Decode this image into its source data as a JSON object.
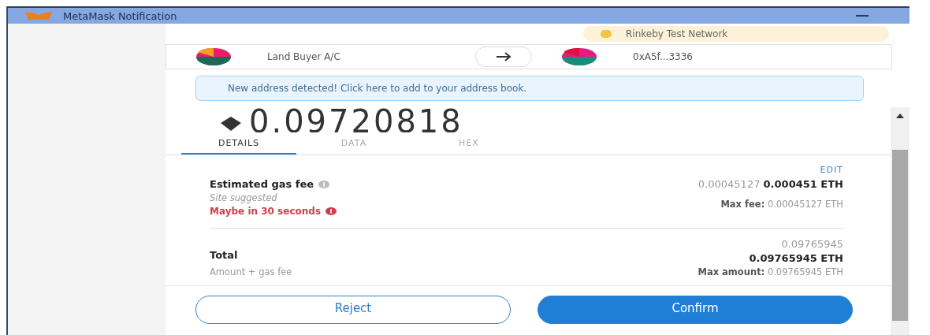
{
  "window": {
    "title": "MetaMask Notification"
  },
  "network": {
    "name": "Rinkeby Test Network",
    "color": "#f6c343"
  },
  "sender": {
    "name": "Land Buyer A/C"
  },
  "recipient": {
    "address": "0xA5f...3336"
  },
  "notice": "New address detected! Click here to add to your address book.",
  "amount": "0.09720818",
  "tabs": [
    {
      "label": "DETAILS",
      "selected": true
    },
    {
      "label": "DATA",
      "selected": false
    },
    {
      "label": "HEX",
      "selected": false
    }
  ],
  "edit_link": "EDIT",
  "gas_fee": {
    "label": "Estimated gas fee",
    "value": "0.00045127 **0.000451 ETH**",
    "source": "Site suggested",
    "timing": "Maybe in 30 seconds",
    "max": "**Max fee:** 0.00045127 ETH"
  },
  "total": {
    "label": "Total",
    "amount": "0.09765945",
    "value": "0.09765945 ETH",
    "note": "Amount + gas fee",
    "max": "**Max amount:** 0.09765945 ETH"
  },
  "buttons": [
    {
      "label": "Reject",
      "kind": "secondary"
    },
    {
      "label": "Confirm",
      "kind": "primary"
    }
  ]
}
